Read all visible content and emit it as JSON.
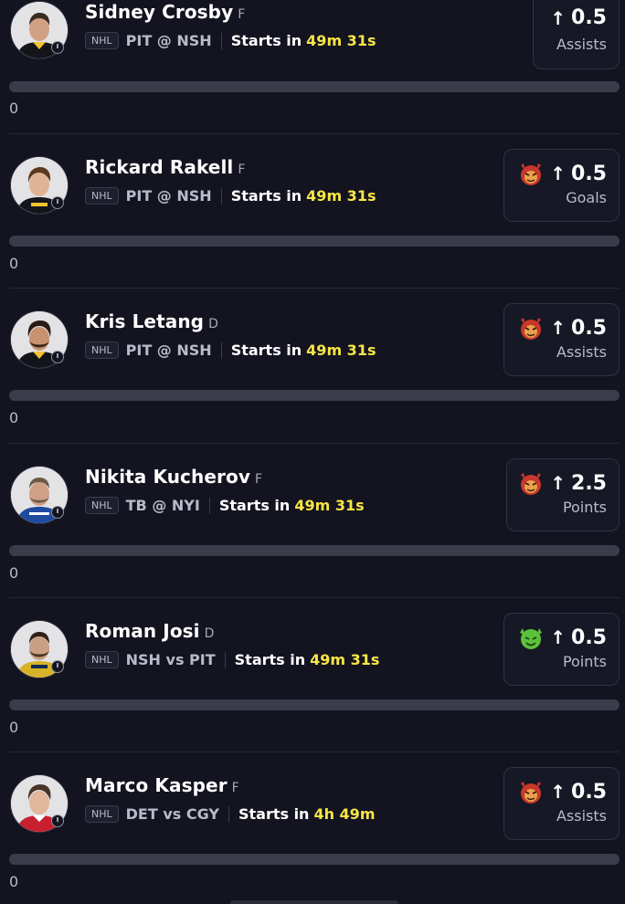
{
  "players": [
    {
      "name": "Sidney Crosby",
      "position": "F",
      "league": "NHL",
      "matchup": "PIT @ NSH",
      "starts_label": "Starts in",
      "countdown": "49m 31s",
      "direction_icon": "arrow-up-icon",
      "line": "0.5",
      "stat": "Assists",
      "badge": null,
      "progress": 0,
      "count": "0"
    },
    {
      "name": "Rickard Rakell",
      "position": "F",
      "league": "NHL",
      "matchup": "PIT @ NSH",
      "starts_label": "Starts in",
      "countdown": "49m 31s",
      "direction_icon": "arrow-up-icon",
      "line": "0.5",
      "stat": "Goals",
      "badge": "red-demon-icon",
      "progress": 0,
      "count": "0"
    },
    {
      "name": "Kris Letang",
      "position": "D",
      "league": "NHL",
      "matchup": "PIT @ NSH",
      "starts_label": "Starts in",
      "countdown": "49m 31s",
      "direction_icon": "arrow-up-icon",
      "line": "0.5",
      "stat": "Assists",
      "badge": "red-demon-icon",
      "progress": 0,
      "count": "0"
    },
    {
      "name": "Nikita Kucherov",
      "position": "F",
      "league": "NHL",
      "matchup": "TB @ NYI",
      "starts_label": "Starts in",
      "countdown": "49m 31s",
      "direction_icon": "arrow-up-icon",
      "line": "2.5",
      "stat": "Points",
      "badge": "red-demon-icon",
      "progress": 0,
      "count": "0"
    },
    {
      "name": "Roman Josi",
      "position": "D",
      "league": "NHL",
      "matchup": "NSH vs PIT",
      "starts_label": "Starts in",
      "countdown": "49m 31s",
      "direction_icon": "arrow-up-icon",
      "line": "0.5",
      "stat": "Points",
      "badge": "green-goblin-icon",
      "progress": 0,
      "count": "0"
    },
    {
      "name": "Marco Kasper",
      "position": "F",
      "league": "NHL",
      "matchup": "DET vs CGY",
      "starts_label": "Starts in",
      "countdown": "4h 49m",
      "direction_icon": "arrow-up-icon",
      "line": "0.5",
      "stat": "Assists",
      "badge": "red-demon-icon",
      "progress": 0,
      "count": "0"
    }
  ],
  "colors": {
    "background": "#131420",
    "countdown": "#f8e547",
    "red_badge": "#c9372c",
    "green_badge": "#5cc13a",
    "bar_track": "#3a3c4a"
  }
}
